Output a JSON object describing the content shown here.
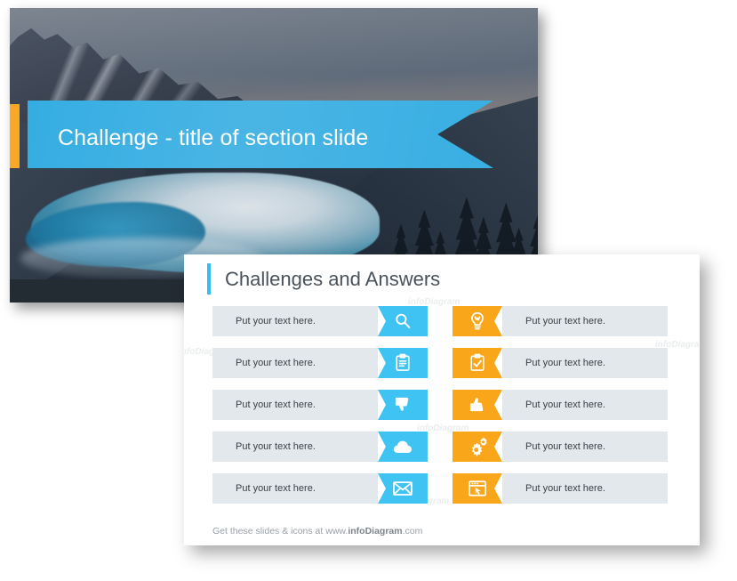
{
  "colors": {
    "blue": "#3FC3F2",
    "banner_blue": "#35ADE2",
    "orange": "#FAA61A",
    "accent_orange": "#F9A825",
    "row_gray": "#E2E8EB",
    "title_gray": "#4a525c"
  },
  "section_slide": {
    "title": "Challenge - title of section slide",
    "footer_text": "Get these slides & icons at www.infoDiagram.com",
    "footer_visible_fragment": "Get t"
  },
  "content_slide": {
    "heading": "Challenges and Answers",
    "watermark": "infoDiagram",
    "footer": {
      "prefix": "Get these slides & icons at www.",
      "brand": "infoDiagram",
      "suffix": ".com"
    },
    "rows": [
      {
        "left": {
          "text": "Put your text here.",
          "icon": "magnifier-icon"
        },
        "right": {
          "text": "Put your text here.",
          "icon": "lightbulb-icon"
        }
      },
      {
        "left": {
          "text": "Put your text here.",
          "icon": "clipboard-icon"
        },
        "right": {
          "text": "Put your text here.",
          "icon": "checklist-icon"
        }
      },
      {
        "left": {
          "text": "Put your text here.",
          "icon": "thumbs-down-icon"
        },
        "right": {
          "text": "Put your text here.",
          "icon": "thumbs-up-icon"
        }
      },
      {
        "left": {
          "text": "Put your text here.",
          "icon": "cloud-icon"
        },
        "right": {
          "text": "Put your text here.",
          "icon": "gears-icon"
        }
      },
      {
        "left": {
          "text": "Put your text here.",
          "icon": "envelope-icon"
        },
        "right": {
          "text": "Put your text here.",
          "icon": "browser-cursor-icon"
        }
      }
    ]
  }
}
